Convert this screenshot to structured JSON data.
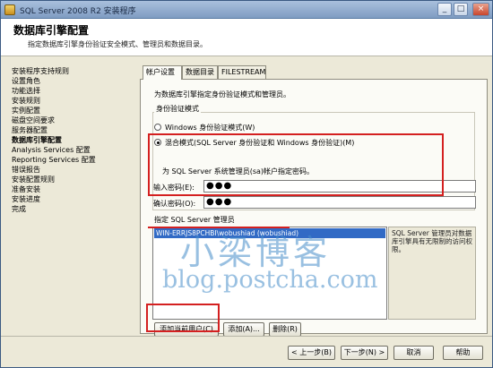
{
  "window": {
    "title": "SQL Server 2008 R2 安装程序",
    "minimize": "_",
    "maximize": "□",
    "close": "×"
  },
  "header": {
    "title": "数据库引擎配置",
    "subtitle": "指定数据库引擎身份验证安全模式、管理员和数据目录。"
  },
  "nav": {
    "items": [
      "安装程序支持规则",
      "设置角色",
      "功能选择",
      "安装规则",
      "实例配置",
      "磁盘空间要求",
      "服务器配置",
      "数据库引擎配置",
      "Analysis Services 配置",
      "Reporting Services 配置",
      "错误报告",
      "安装配置规则",
      "准备安装",
      "安装进度",
      "完成"
    ],
    "active_index": 7
  },
  "tabs": [
    "帐户设置",
    "数据目录",
    "FILESTREAM"
  ],
  "account": {
    "description": "为数据库引擎指定身份验证模式和管理员。",
    "auth_group_label": "身份验证模式",
    "windows_auth": "Windows 身份验证模式(W)",
    "mixed_auth": "混合模式(SQL Server 身份验证和 Windows 身份验证)(M)",
    "sa_prompt": "为 SQL Server 系统管理员(sa)帐户指定密码。",
    "password_label": "输入密码(E):",
    "password_value": "●●●",
    "confirm_label": "确认密码(O):",
    "confirm_value": "●●●",
    "admins_label": "指定 SQL Server 管理员",
    "admins": [
      "WIN-ERRJS8PCHBI\\wobushiad (wobushiad)"
    ],
    "admins_info": "SQL Server 管理员对数据库引擎具有无限制的访问权限。",
    "add_current_user": "添加当前用户(C)",
    "add": "添加(A)...",
    "remove": "删除(R)"
  },
  "footer": {
    "back": "< 上一步(B)",
    "next": "下一步(N) >",
    "cancel": "取消",
    "help": "帮助"
  },
  "watermark": {
    "text": "小梁博客",
    "url": "blog.postcha.com"
  },
  "colors": {
    "highlight": "#d42020",
    "selection": "#316ac5",
    "watermark": "#468cc8"
  }
}
